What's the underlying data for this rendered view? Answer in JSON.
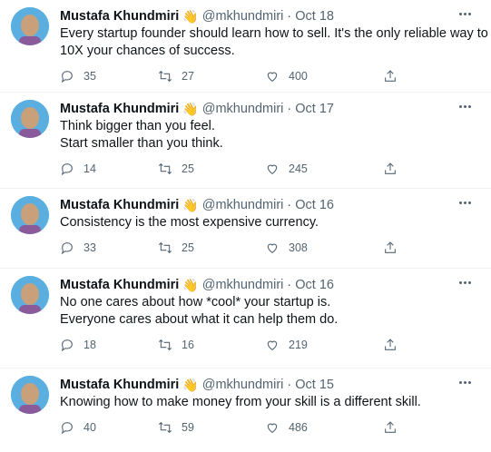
{
  "tweets": [
    {
      "author": "Mustafa Khundmiri",
      "emoji": "👋",
      "handle": "@mkhundmiri",
      "separator": "·",
      "date": "Oct 18",
      "lines": [
        "Every startup founder should learn how to sell. It's the only reliable way to",
        "10X your chances of success."
      ],
      "replies": "35",
      "retweets": "27",
      "likes": "400"
    },
    {
      "author": "Mustafa Khundmiri",
      "emoji": "👋",
      "handle": "@mkhundmiri",
      "separator": "·",
      "date": "Oct 17",
      "lines": [
        "Think bigger than you feel.",
        "Start smaller than you think."
      ],
      "replies": "14",
      "retweets": "25",
      "likes": "245"
    },
    {
      "author": "Mustafa Khundmiri",
      "emoji": "👋",
      "handle": "@mkhundmiri",
      "separator": "·",
      "date": "Oct 16",
      "lines": [
        "Consistency is the most expensive currency."
      ],
      "replies": "33",
      "retweets": "25",
      "likes": "308"
    },
    {
      "author": "Mustafa Khundmiri",
      "emoji": "👋",
      "handle": "@mkhundmiri",
      "separator": "·",
      "date": "Oct 16",
      "lines": [
        "No one cares about how *cool* your startup is.",
        "Everyone cares about what it can help them do."
      ],
      "replies": "18",
      "retweets": "16",
      "likes": "219"
    },
    {
      "author": "Mustafa Khundmiri",
      "emoji": "👋",
      "handle": "@mkhundmiri",
      "separator": "·",
      "date": "Oct 15",
      "lines": [
        "Knowing how to make money from your skill is a different skill."
      ],
      "replies": "40",
      "retweets": "59",
      "likes": "486"
    }
  ],
  "icons": {
    "avatar": "profile-photo",
    "more": "more-horizontal-icon",
    "reply": "reply-icon",
    "retweet": "retweet-icon",
    "like": "heart-icon",
    "share": "share-icon"
  },
  "colors": {
    "text": "#0f1419",
    "muted": "#536471",
    "divider": "#eff3f4"
  }
}
